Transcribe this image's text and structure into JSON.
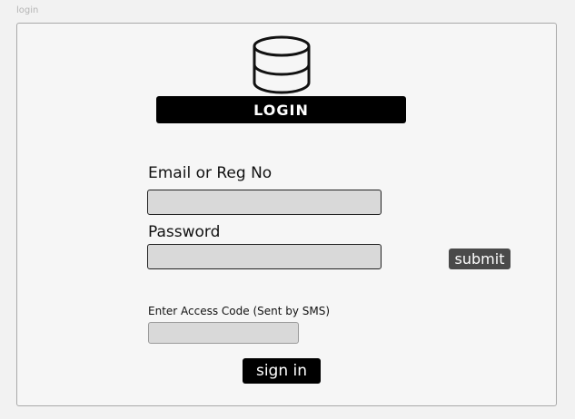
{
  "page": {
    "label": "login"
  },
  "banner": {
    "icon": "database-icon",
    "title": "LOGIN"
  },
  "form": {
    "email": {
      "label": "Email or Reg No",
      "value": "",
      "placeholder": ""
    },
    "password": {
      "label": "Password",
      "value": "",
      "placeholder": ""
    },
    "submit_label": "submit",
    "access_code": {
      "label": "Enter Access Code (Sent by SMS)",
      "value": "",
      "placeholder": ""
    },
    "signin_label": "sign in"
  },
  "colors": {
    "banner_bg": "#000000",
    "input_bg": "#d9d9d9",
    "submit_bg": "#4a4a4a",
    "signin_bg": "#000000"
  }
}
